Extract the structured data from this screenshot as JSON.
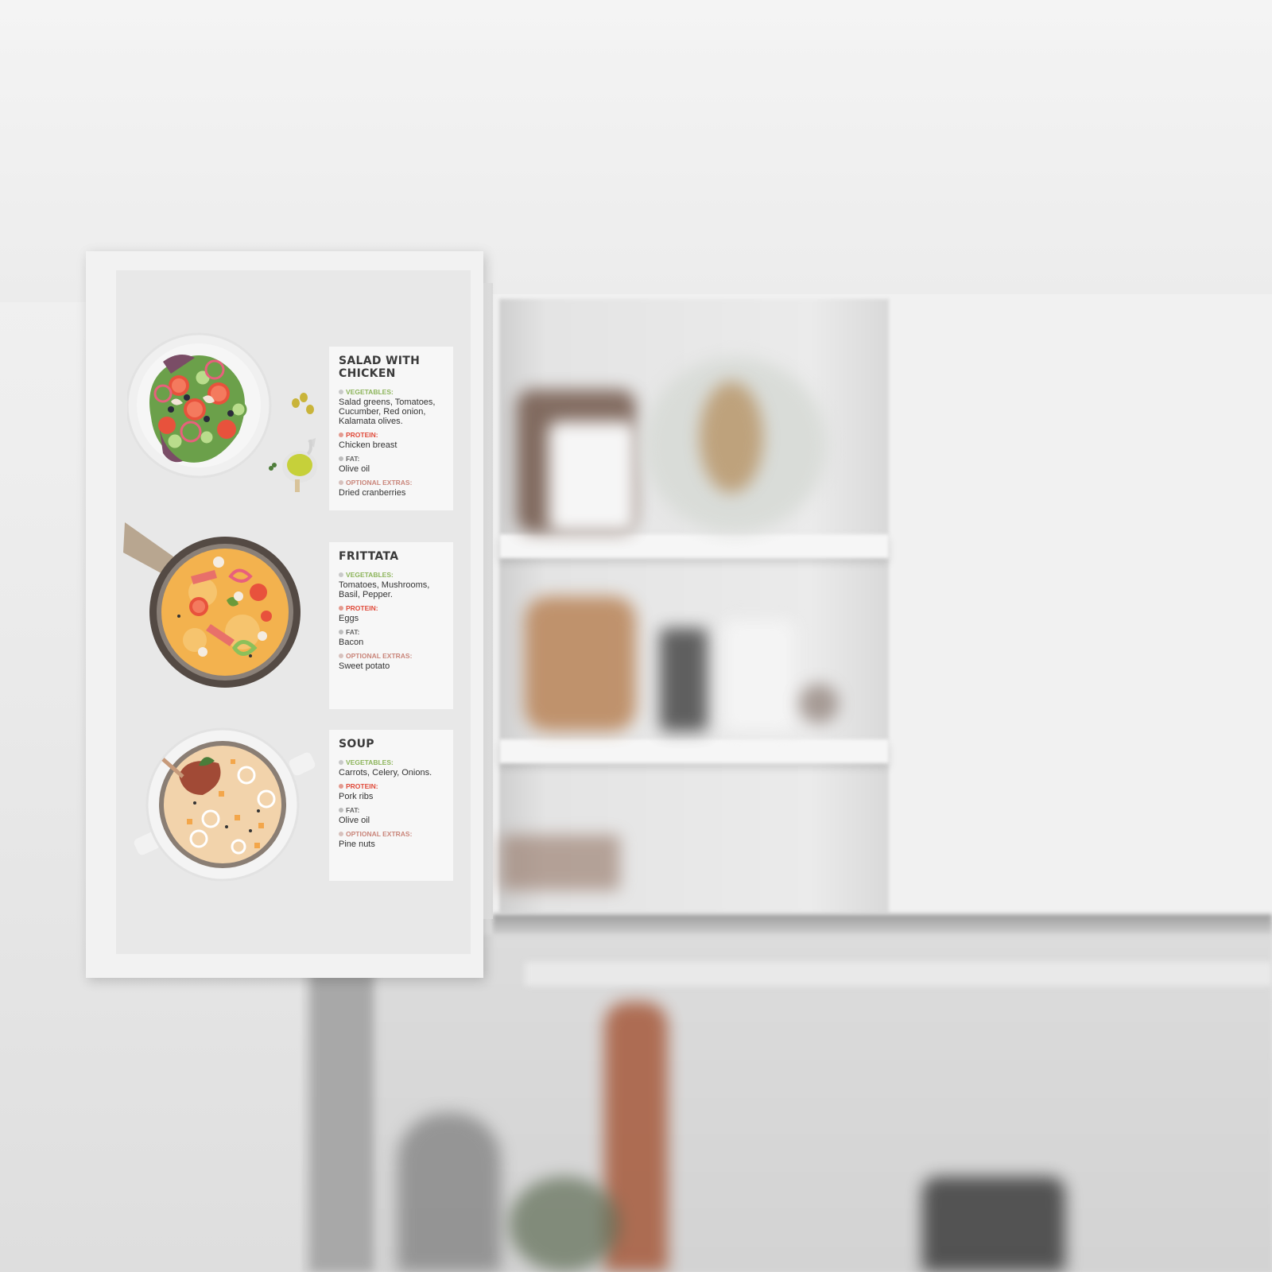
{
  "poster": {
    "recipes": [
      {
        "title": "SALAD WITH CHICKEN",
        "vegetables_label": "VEGETABLES:",
        "vegetables": "Salad greens, Tomatoes, Cucumber, Red onion, Kalamata olives.",
        "protein_label": "PROTEIN:",
        "protein": "Chicken breast",
        "fat_label": "FAT:",
        "fat": "Olive oil",
        "extras_label": "OPTIONAL EXTRAS:",
        "extras": "Dried cranberries"
      },
      {
        "title": "FRITTATA",
        "vegetables_label": "VEGETABLES:",
        "vegetables": "Tomatoes, Mushrooms, Basil, Pepper.",
        "protein_label": "PROTEIN:",
        "protein": "Eggs",
        "fat_label": "FAT:",
        "fat": "Bacon",
        "extras_label": "OPTIONAL EXTRAS:",
        "extras": "Sweet potato"
      },
      {
        "title": "SOUP",
        "vegetables_label": "VEGETABLES:",
        "vegetables": "Carrots, Celery, Onions.",
        "protein_label": "PROTEIN:",
        "protein": "Pork ribs",
        "fat_label": "FAT:",
        "fat": "Olive oil",
        "extras_label": "OPTIONAL EXTRAS:",
        "extras": "Pine nuts"
      }
    ]
  },
  "colors": {
    "vegetables_label": "#8cb45a",
    "protein_label": "#e04a3a",
    "fat_label": "#666666",
    "extras_label": "#c9857a"
  },
  "icons": [
    "salad-plate-icon",
    "frittata-pan-icon",
    "soup-pot-icon",
    "olive-oil-jug-icon"
  ]
}
